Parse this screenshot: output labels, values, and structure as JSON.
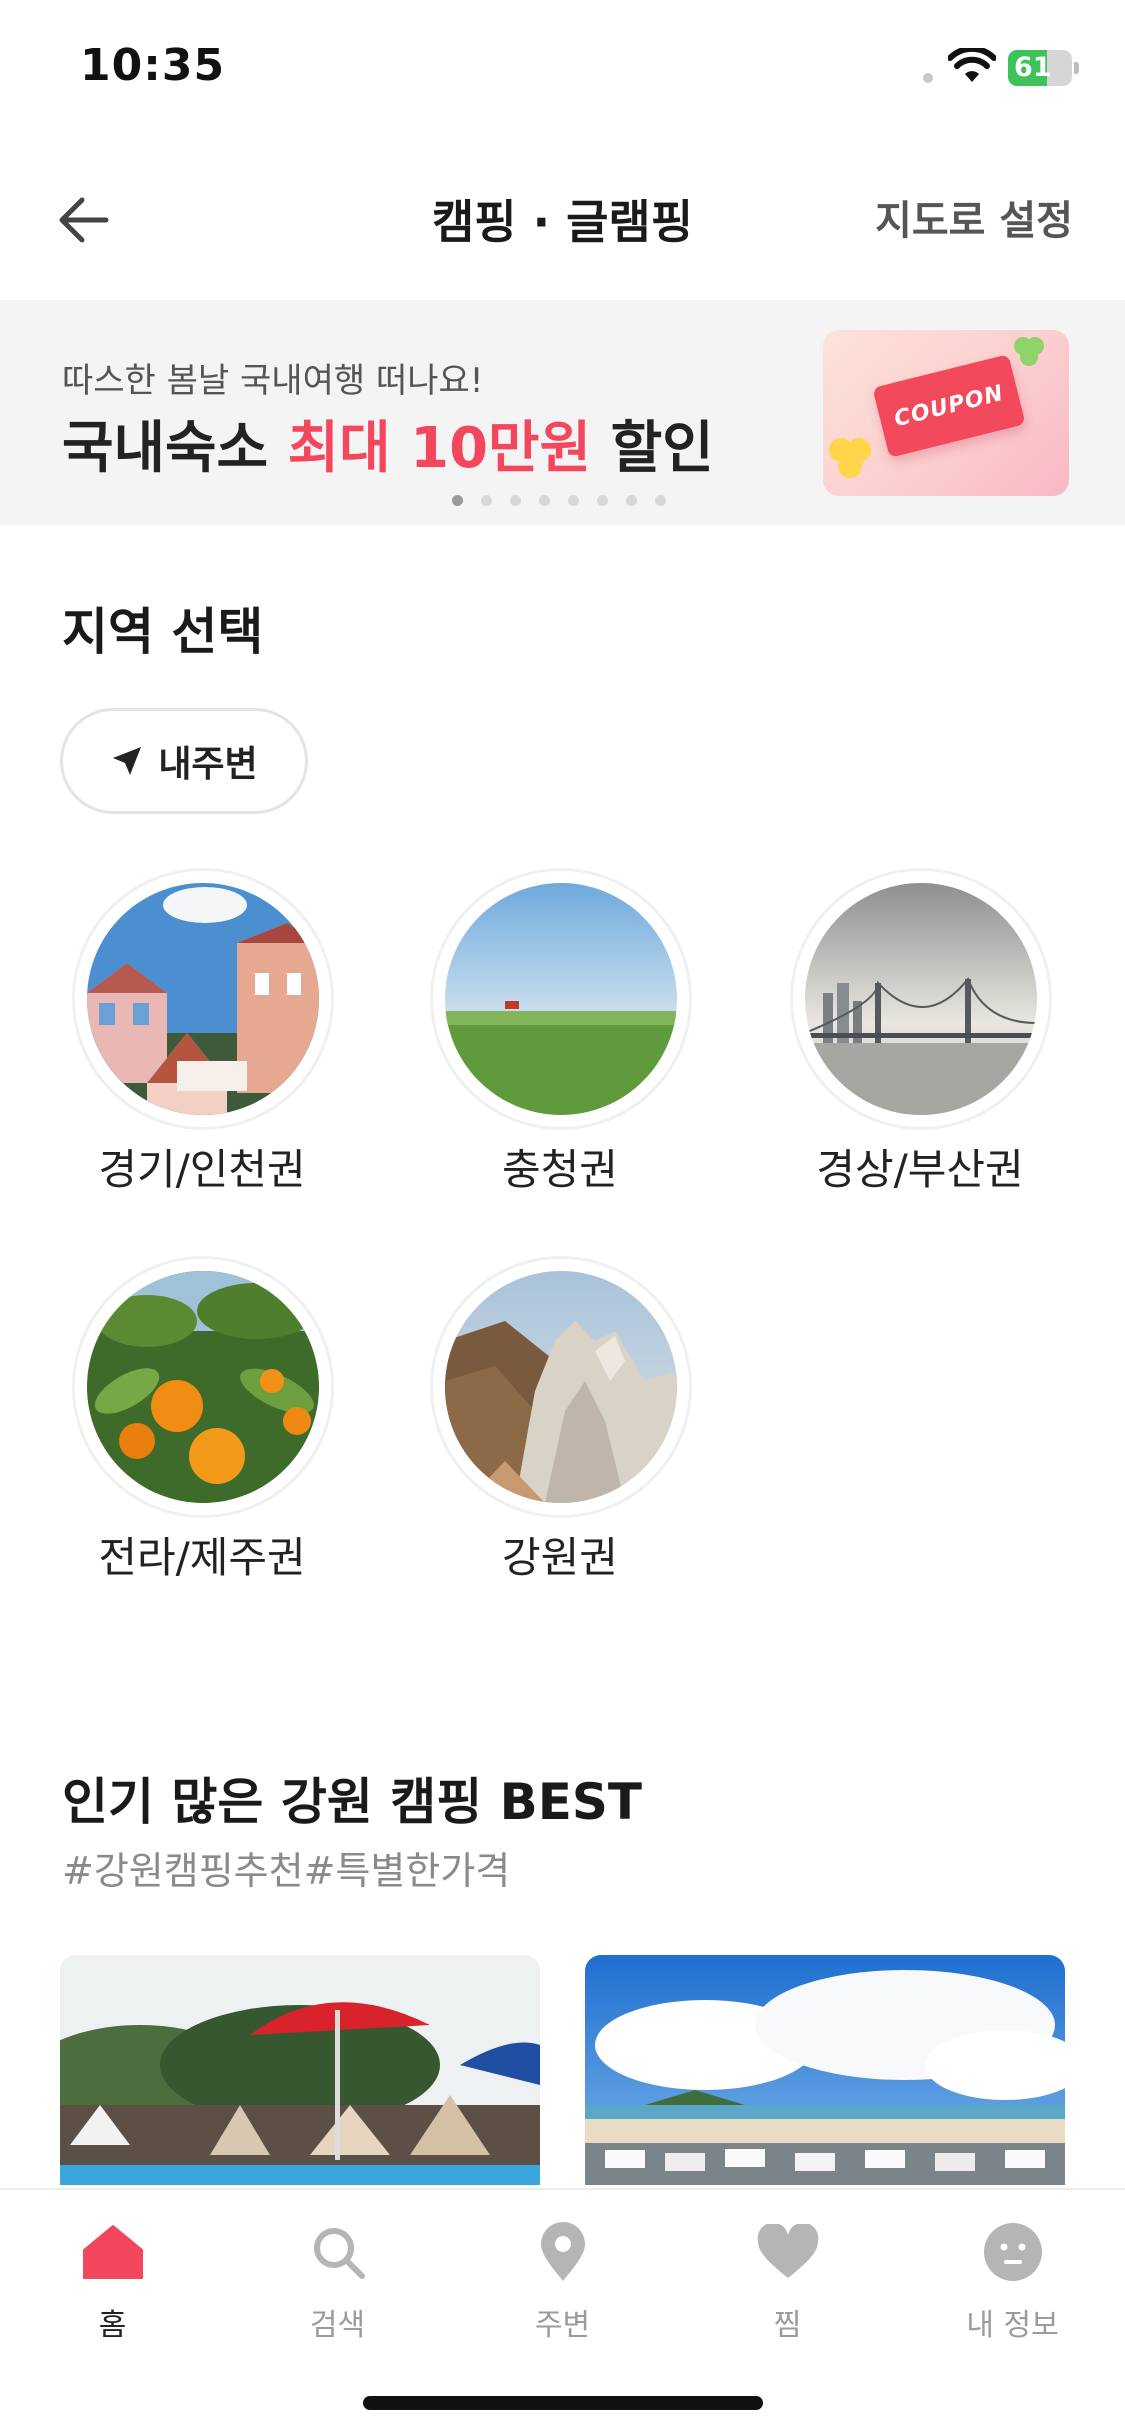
{
  "status": {
    "time": "10:35",
    "battery": "61",
    "battery_level": 0.61
  },
  "header": {
    "title": "캠핑 · 글램핑",
    "map_link": "지도로 설정"
  },
  "banner": {
    "subtitle": "따스한 봄날 국내여행 떠나요!",
    "title_part1": "국내숙소 ",
    "title_highlight": "최대 10만원",
    "title_part2": " 할인",
    "coupon_text": "COUPON",
    "page_count": 8,
    "active_page": 1
  },
  "region_section": {
    "title": "지역 선택",
    "nearby_label": "내주변",
    "regions": [
      {
        "name": "경기/인천권",
        "image": "town-houses"
      },
      {
        "name": "충청권",
        "image": "green-field"
      },
      {
        "name": "경상/부산권",
        "image": "bridge-city"
      },
      {
        "name": "전라/제주권",
        "image": "tangerines"
      },
      {
        "name": "강원권",
        "image": "rock-mountain"
      }
    ]
  },
  "best_section": {
    "title": "인기 많은 강원 캠핑 BEST",
    "hashtags": "#강원캠핑추천#특별한가격",
    "cards": [
      {
        "image": "pool-glamping"
      },
      {
        "image": "beach-campsite"
      }
    ]
  },
  "tabbar": {
    "tabs": [
      {
        "label": "홈",
        "icon": "home-icon",
        "active": true
      },
      {
        "label": "검색",
        "icon": "search-icon",
        "active": false
      },
      {
        "label": "주변",
        "icon": "location-pin-icon",
        "active": false
      },
      {
        "label": "찜",
        "icon": "heart-icon",
        "active": false
      },
      {
        "label": "내 정보",
        "icon": "profile-icon",
        "active": false
      }
    ]
  },
  "colors": {
    "accent": "#f2475d",
    "text": "#222222",
    "muted": "#9b9b9b",
    "banner_bg": "#f4f4f4"
  }
}
